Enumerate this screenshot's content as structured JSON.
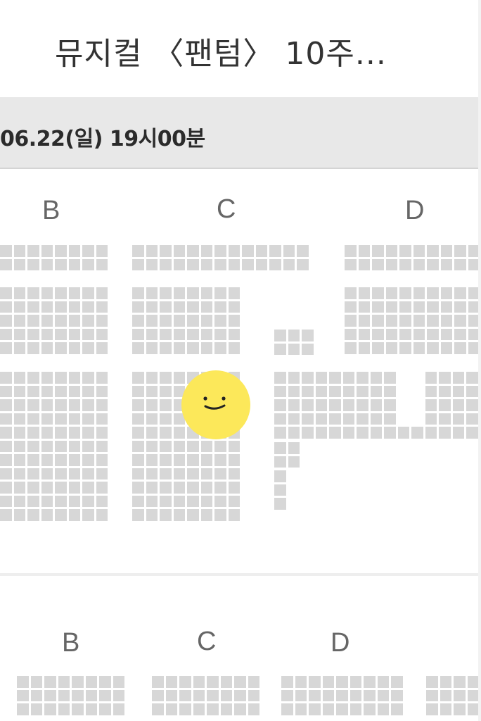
{
  "header": {
    "title": "뮤지컬 〈팬텀〉 10주..."
  },
  "performance": {
    "datetime": "06.22(일) 19시00분"
  },
  "floor1": {
    "sections": [
      {
        "label": "B"
      },
      {
        "label": "C"
      },
      {
        "label": "D"
      }
    ]
  },
  "floor2": {
    "sections": [
      {
        "label": "B"
      },
      {
        "label": "C"
      },
      {
        "label": "D"
      }
    ]
  },
  "colors": {
    "seat": "#d7d7d7",
    "datebar": "#e8e8e8",
    "avatar": "#fce85a"
  },
  "icons": {
    "avatar": "smiley-face-icon"
  }
}
